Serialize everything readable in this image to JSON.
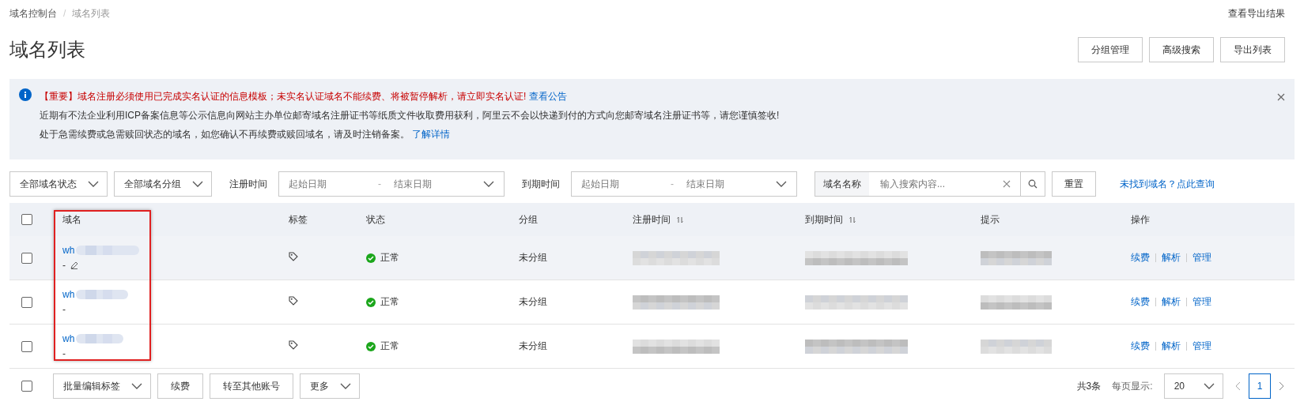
{
  "breadcrumb": [
    {
      "label": "域名控制台",
      "current": false
    },
    {
      "label": "域名列表",
      "current": true
    }
  ],
  "breadcrumb_separator": "/",
  "top_link": "查看导出结果",
  "title": "域名列表",
  "header_buttons": [
    "分组管理",
    "高级搜索",
    "导出列表"
  ],
  "notice": {
    "lines": [
      {
        "kind": "warning",
        "text": "【重要】域名注册必须使用已完成实名认证的信息模板；未实名认证域名不能续费、将被暂停解析，请立即实名认证!",
        "link": "查看公告"
      },
      {
        "kind": "plain",
        "text": "近期有不法企业利用ICP备案信息等公示信息向网站主办单位邮寄域名注册证书等纸质文件收取费用获利，阿里云不会以快递到付的方式向您邮寄域名注册证书等，请您谨慎签收!"
      },
      {
        "kind": "plain",
        "text": "处于急需续费或急需赎回状态的域名，如您确认不再续费或赎回域名，请及时注销备案。",
        "link": "了解详情"
      }
    ]
  },
  "filters": {
    "status_select": "全部域名状态",
    "group_select": "全部域名分组",
    "reg_time": {
      "label": "注册时间",
      "start_placeholder": "起始日期",
      "separator": "-",
      "end_placeholder": "结束日期"
    },
    "exp_time": {
      "label": "到期时间",
      "start_placeholder": "起始日期",
      "separator": "-",
      "end_placeholder": "结束日期"
    },
    "search": {
      "category": "域名名称",
      "placeholder": "输入搜索内容..."
    },
    "reset_button": "重置",
    "help_link": "未找到域名？点此查询"
  },
  "table": {
    "all_checked": false,
    "columns": [
      {
        "label": "域名",
        "sortable": false
      },
      {
        "label": "标签",
        "sortable": false
      },
      {
        "label": "状态",
        "sortable": false
      },
      {
        "label": "分组",
        "sortable": false
      },
      {
        "label": "注册时间",
        "sortable": true
      },
      {
        "label": "到期时间",
        "sortable": true
      },
      {
        "label": "提示",
        "sortable": false
      },
      {
        "label": "操作",
        "sortable": false
      }
    ],
    "rows": [
      {
        "checked": false,
        "hovered": true,
        "domain": "wh",
        "note": "-",
        "editable": true,
        "status": "正常",
        "group": "未分组",
        "actions": [
          "续费",
          "解析",
          "管理"
        ]
      },
      {
        "checked": false,
        "hovered": false,
        "domain": "wh",
        "note": "-",
        "editable": false,
        "status": "正常",
        "group": "未分组",
        "actions": [
          "续费",
          "解析",
          "管理"
        ]
      },
      {
        "checked": false,
        "hovered": false,
        "domain": "wh",
        "note": "-",
        "editable": false,
        "status": "正常",
        "group": "未分组",
        "actions": [
          "续费",
          "解析",
          "管理"
        ]
      }
    ]
  },
  "footer": {
    "select_all_checked": false,
    "batch_select": "批量编辑标签",
    "buttons": [
      "续费",
      "转至其他账号"
    ],
    "more_select": "更多",
    "total": "共3条",
    "page_size_label": "每页显示:",
    "page_size": "20",
    "pages": [
      {
        "label": "1",
        "selected": true
      }
    ]
  }
}
